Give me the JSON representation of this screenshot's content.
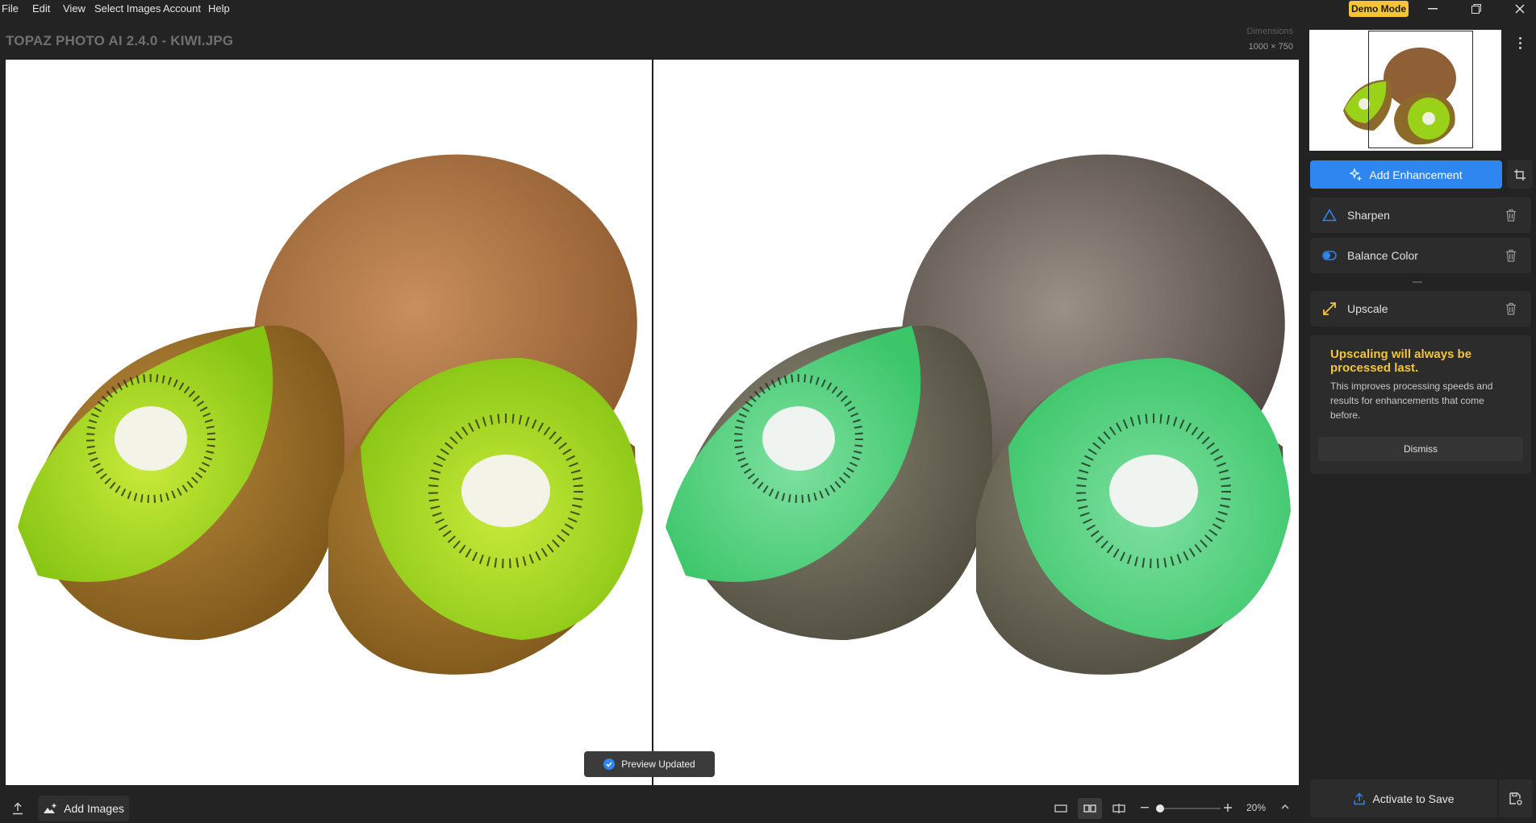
{
  "menu": [
    "File",
    "Edit",
    "View",
    "Select Images",
    "Account",
    "Help"
  ],
  "demo_badge": "Demo Mode",
  "title": "TOPAZ PHOTO AI 2.4.0 - KIWI.JPG",
  "dimensions": {
    "label": "Dimensions",
    "value": "1000 × 750"
  },
  "toast": "Preview Updated",
  "panel": {
    "add_enhancement": "Add Enhancement",
    "enhancements": [
      {
        "label": "Sharpen",
        "icon": "triangle-icon"
      },
      {
        "label": "Balance Color",
        "icon": "toggle-icon"
      },
      {
        "label": "Upscale",
        "icon": "expand-arrows-icon"
      }
    ],
    "info": {
      "title": "Upscaling will always be processed last.",
      "body": "This improves processing speeds and results for enhancements that come before.",
      "dismiss": "Dismiss"
    },
    "activate": "Activate to Save"
  },
  "bottom": {
    "add_images": "Add Images",
    "zoom": "20%"
  },
  "colors": {
    "accent": "#2e86f0",
    "warning": "#f4c534",
    "bg": "#232323"
  }
}
